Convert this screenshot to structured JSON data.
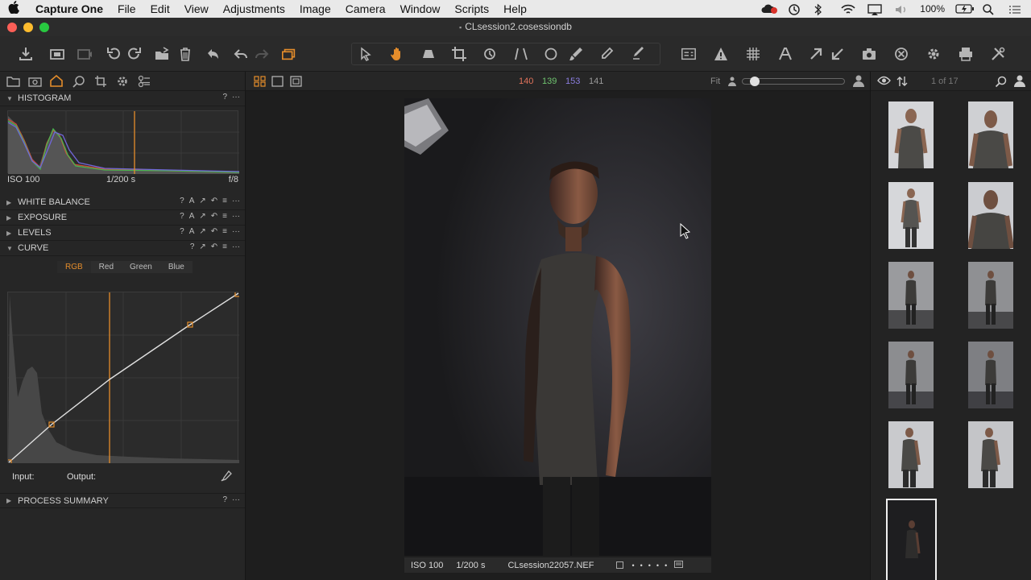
{
  "menubar": {
    "app_name": "Capture One",
    "menus": [
      "File",
      "Edit",
      "View",
      "Adjustments",
      "Image",
      "Camera",
      "Window",
      "Scripts",
      "Help"
    ],
    "battery": "100%"
  },
  "window": {
    "title": "CLsession2.cosessiondb"
  },
  "viewer": {
    "readout_r": "140",
    "readout_g": "139",
    "readout_b": "153",
    "readout_l": "141",
    "fit_label": "Fit",
    "photo_iso": "ISO 100",
    "photo_shutter": "1/200 s",
    "photo_filename": "CLsession22057.NEF"
  },
  "browser": {
    "count": "1 of 17"
  },
  "tools": {
    "histogram": {
      "label": "HISTOGRAM",
      "iso": "ISO 100",
      "shutter": "1/200 s",
      "aperture": "f/8"
    },
    "white_balance": "WHITE BALANCE",
    "exposure": "EXPOSURE",
    "levels": "LEVELS",
    "curve": {
      "label": "CURVE",
      "tabs": [
        "RGB",
        "Red",
        "Green",
        "Blue"
      ],
      "input_label": "Input:",
      "output_label": "Output:"
    },
    "process_summary": "PROCESS SUMMARY"
  },
  "colors": {
    "accent": "#e58d2b",
    "readout_r": "#e2735b",
    "readout_g": "#6fc36f",
    "readout_b": "#8b7ee0",
    "readout_l": "#9a9a9a"
  }
}
